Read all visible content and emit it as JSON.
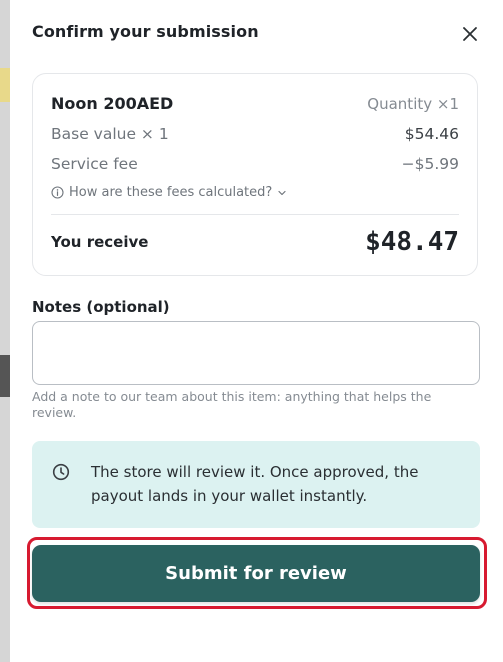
{
  "modal": {
    "title": "Confirm your submission",
    "close_icon": "close-icon"
  },
  "summary": {
    "product_name": "Noon 200AED",
    "quantity": "Quantity ×1",
    "base_value_label": "Base value × 1",
    "base_value": "$54.46",
    "service_fee_label": "Service fee",
    "service_fee": "−$5.99",
    "fees_link": "How are these fees calculated?",
    "fees_link_icon": "info-icon",
    "fees_chevron_icon": "chevron-down-icon",
    "receive_label": "You receive",
    "receive_amount": "$48.47"
  },
  "notes": {
    "label": "Notes (optional)",
    "value": "",
    "placeholder": "",
    "help_text": "Add a note to our team about this item: anything that helps the review."
  },
  "info": {
    "icon": "clock-icon",
    "text": "The store will review it. Once approved, the payout lands in your wallet instantly."
  },
  "actions": {
    "submit_label": "Submit for review"
  },
  "colors": {
    "primary": "#2b6260",
    "info_bg": "#dcf2f1",
    "highlight_outline": "#d71a30"
  }
}
